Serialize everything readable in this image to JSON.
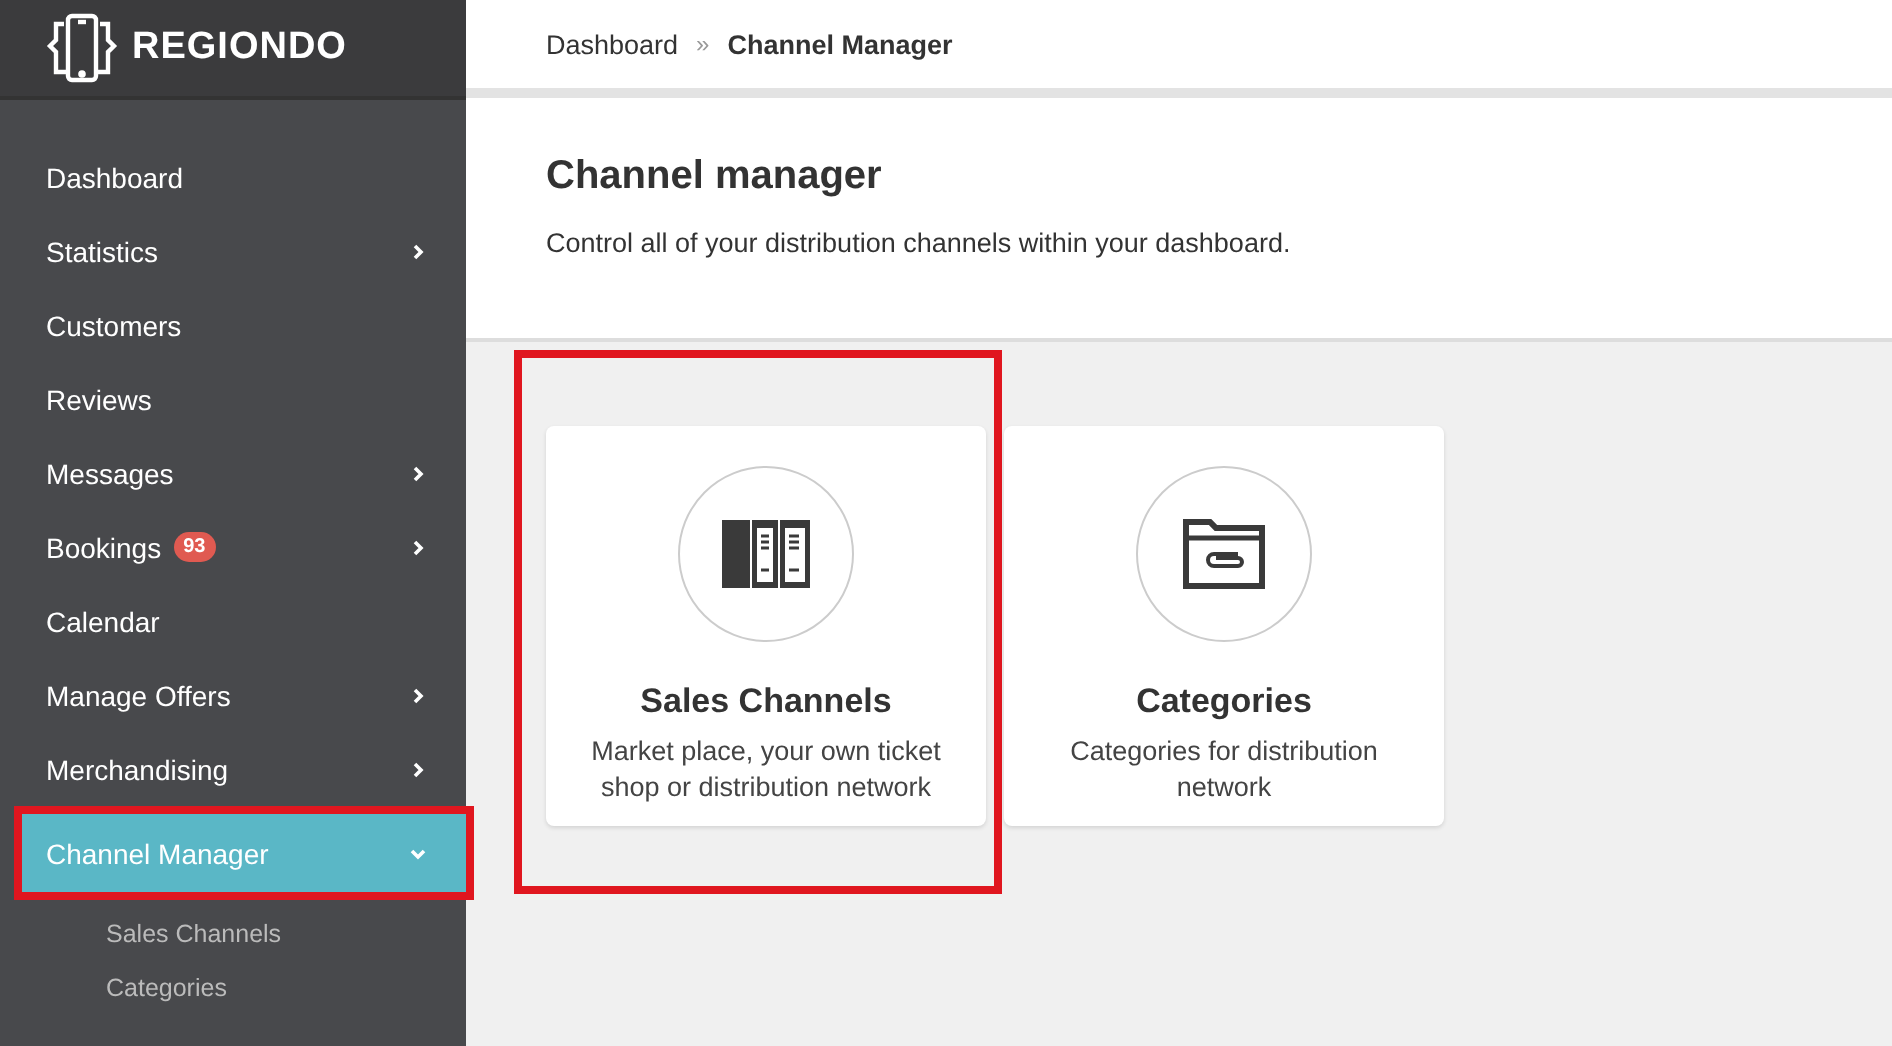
{
  "logo": {
    "text": "REGIONDO"
  },
  "breadcrumb": [
    {
      "label": "Dashboard",
      "current": false
    },
    {
      "label": "Channel Manager",
      "current": true
    }
  ],
  "breadcrumb_separator": "»",
  "sidebar": {
    "items": [
      {
        "label": "Dashboard",
        "has_arrow": false,
        "selected": false,
        "highlighted": false
      },
      {
        "label": "Statistics",
        "has_arrow": true,
        "selected": false,
        "highlighted": false
      },
      {
        "label": "Customers",
        "has_arrow": false,
        "selected": false,
        "highlighted": false
      },
      {
        "label": "Reviews",
        "has_arrow": false,
        "selected": false,
        "highlighted": false
      },
      {
        "label": "Messages",
        "has_arrow": true,
        "selected": false,
        "highlighted": false
      },
      {
        "label": "Bookings",
        "badge": "93",
        "has_arrow": true,
        "selected": false,
        "highlighted": false
      },
      {
        "label": "Calendar",
        "has_arrow": false,
        "selected": false,
        "highlighted": false
      },
      {
        "label": "Manage Offers",
        "has_arrow": true,
        "selected": false,
        "highlighted": false
      },
      {
        "label": "Merchandising",
        "has_arrow": true,
        "selected": false,
        "highlighted": false
      },
      {
        "label": "Channel Manager",
        "has_arrow": true,
        "selected": true,
        "expanded": true,
        "highlighted": true,
        "children": [
          {
            "label": "Sales Channels"
          },
          {
            "label": "Categories"
          }
        ]
      }
    ]
  },
  "page": {
    "title": "Channel manager",
    "subtitle": "Control all of your distribution channels within your dashboard."
  },
  "cards": [
    {
      "kind": "binders",
      "title": "Sales Channels",
      "description": "Market place, your own ticket shop or distribution network",
      "highlighted": true
    },
    {
      "kind": "folder",
      "title": "Categories",
      "description": "Categories for distribution network",
      "highlighted": false
    }
  ]
}
